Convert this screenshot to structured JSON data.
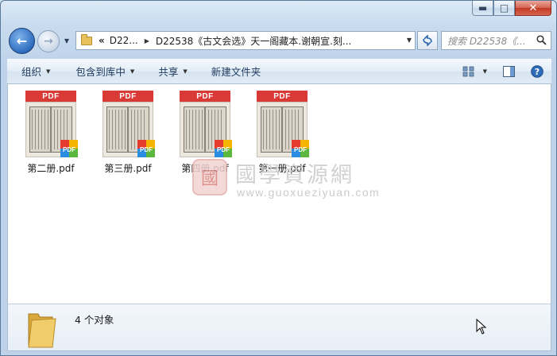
{
  "window": {
    "minimize_glyph": "▭",
    "maximize_glyph": "□",
    "close_glyph": "✕"
  },
  "address": {
    "chevron": "«",
    "segments": [
      "D22...",
      "D22538《古文会选》天一阁藏本.谢朝宣.刻..."
    ],
    "search_placeholder": "搜索 D22538《..."
  },
  "toolbar": {
    "organize": "组织",
    "include_in_library": "包含到库中",
    "share": "共享",
    "new_folder": "新建文件夹"
  },
  "files": [
    {
      "name": "第二册.pdf",
      "badge": "PDF"
    },
    {
      "name": "第三册.pdf",
      "badge": "PDF"
    },
    {
      "name": "第四册.pdf",
      "badge": "PDF"
    },
    {
      "name": "第一册.pdf",
      "badge": "PDF"
    }
  ],
  "watermark": {
    "seal": "國",
    "text": "國學資源網",
    "url": "www.guoxueziyuan.com"
  },
  "status": {
    "count_text": "4 个对象"
  },
  "colors": {
    "pdf_red": "#d93a35",
    "accent_blue": "#2e6cbd",
    "close_red": "#c23a26"
  }
}
